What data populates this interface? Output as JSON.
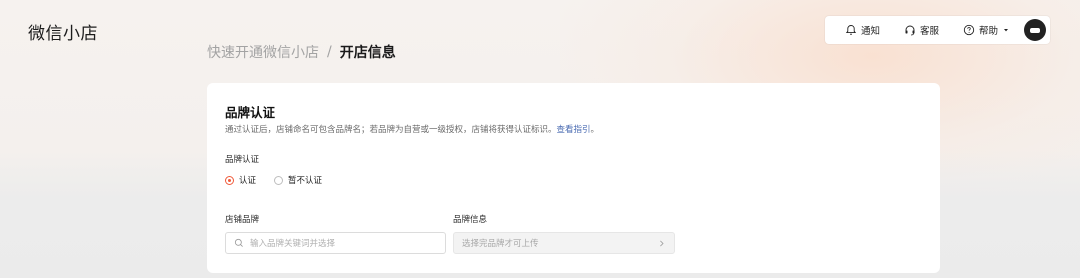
{
  "app": {
    "logo": "微信小店"
  },
  "topbar": {
    "notify": "通知",
    "service": "客服",
    "help": "帮助"
  },
  "breadcrumb": {
    "parent": "快速开通微信小店",
    "separator": "/",
    "current": "开店信息"
  },
  "card": {
    "title": "品牌认证",
    "desc": "通过认证后，店铺命名可包含品牌名；若品牌为自营或一级授权，店铺将获得认证标识。",
    "desc_link": "查看指引",
    "brand_auth_label": "品牌认证",
    "radio_options": [
      {
        "label": "认证",
        "checked": true
      },
      {
        "label": "暂不认证",
        "checked": false
      }
    ],
    "store_brand_label": "店铺品牌",
    "store_brand_placeholder": "输入品牌关键词并选择",
    "brand_info_label": "品牌信息",
    "brand_info_placeholder": "选择完品牌才可上传"
  },
  "colors": {
    "accent": "#f05a3a",
    "link": "#4a6bb2"
  }
}
